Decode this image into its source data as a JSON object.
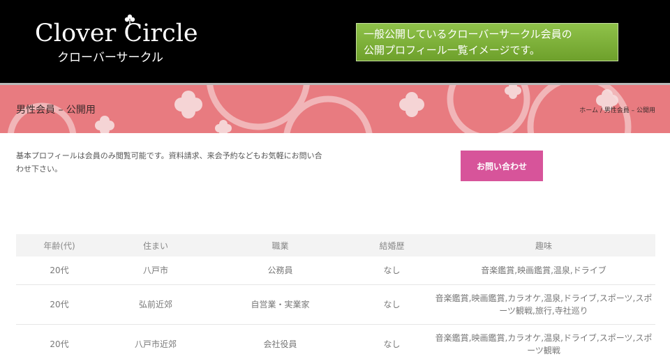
{
  "header": {
    "logo_main": "Clover Circle",
    "logo_sub": "クローバーサークル",
    "notice_line1": "一般公開しているクローバーサークル会員の",
    "notice_line2": "公開プロフィール一覧イメージです。"
  },
  "banner": {
    "title": "男性会員 – 公開用",
    "breadcrumb": [
      "ホーム",
      "男性会員 – 公開用"
    ],
    "breadcrumb_sep": "/"
  },
  "intro": {
    "text": "基本プロフィールは会員のみ閲覧可能です。資料請求、来会予約などもお気軽にお問い合わせ下さい。",
    "contact_button": "お問い合わせ"
  },
  "table": {
    "headers": [
      "年齢(代)",
      "住まい",
      "職業",
      "結婚歴",
      "趣味"
    ],
    "rows": [
      [
        "20代",
        "八戸市",
        "公務員",
        "なし",
        "音楽鑑賞,映画鑑賞,温泉,ドライブ"
      ],
      [
        "20代",
        "弘前近郊",
        "自営業・実業家",
        "なし",
        "音楽鑑賞,映画鑑賞,カラオケ,温泉,ドライブ,スポーツ,スポーツ観戦,旅行,寺社巡り"
      ],
      [
        "20代",
        "八戸市近郊",
        "会社役員",
        "なし",
        "音楽鑑賞,映画鑑賞,カラオケ,温泉,ドライブ,スポーツ,スポーツ観戦"
      ]
    ]
  },
  "colors": {
    "header_bg": "#000000",
    "notice_bg": "#7cb23a",
    "banner_bg": "#e87b80",
    "contact_bg": "#d7549a"
  }
}
